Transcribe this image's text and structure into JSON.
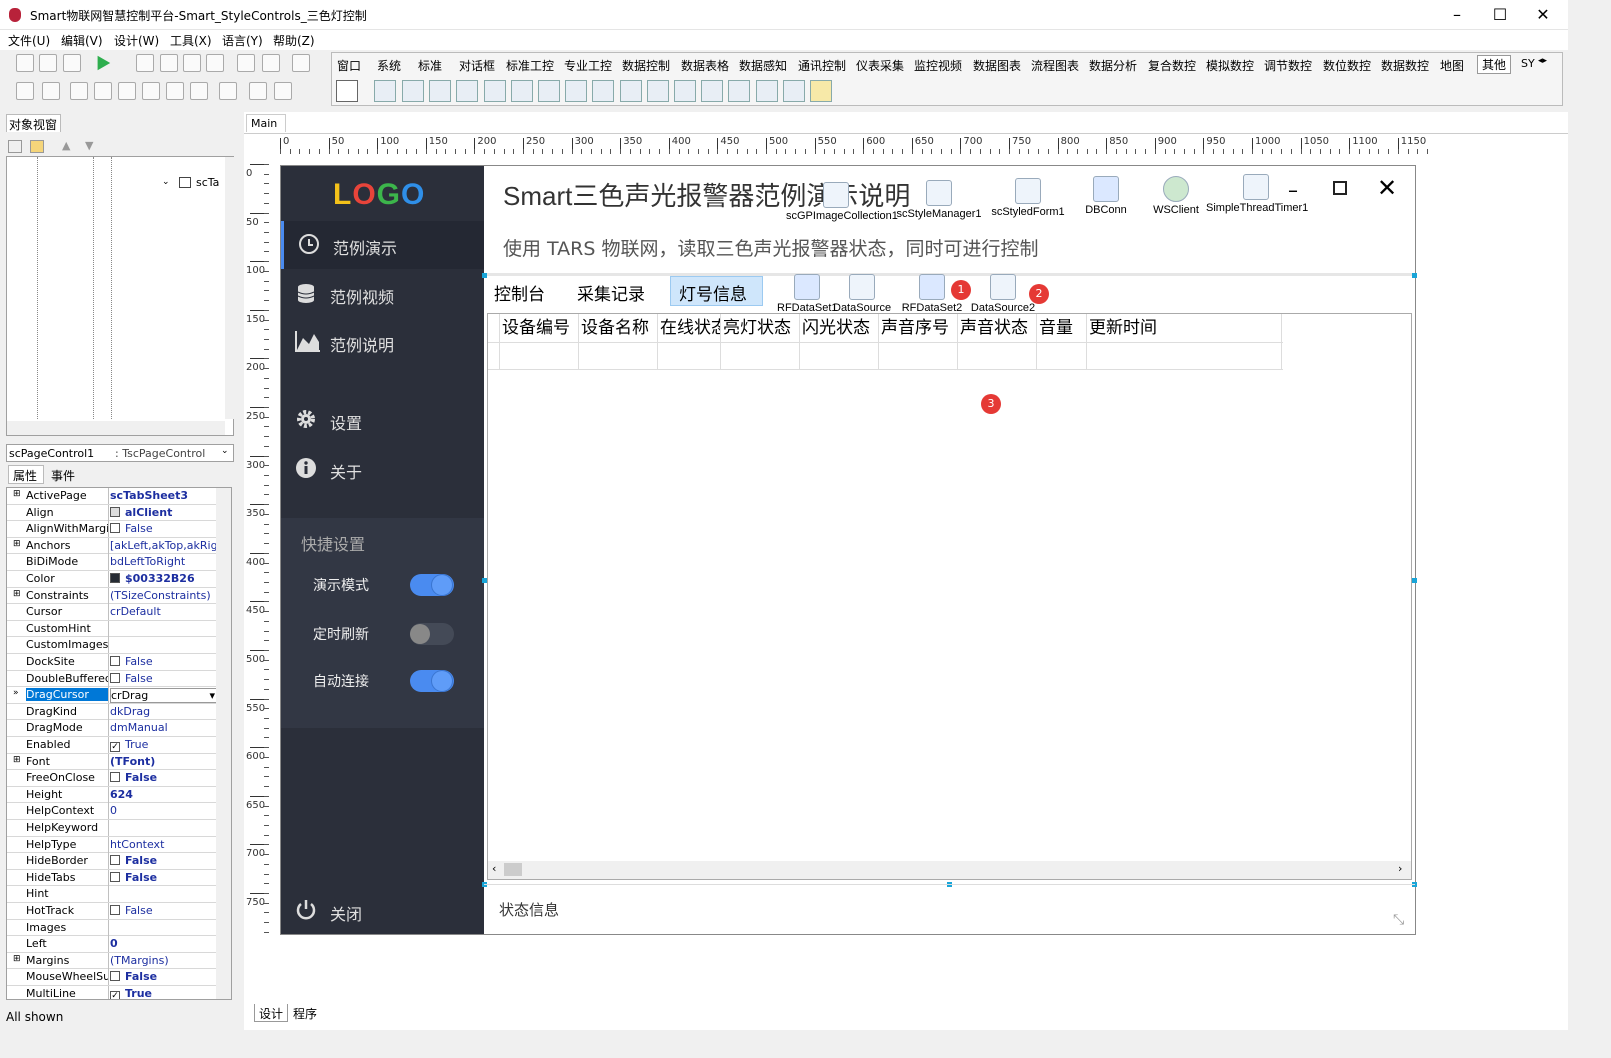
{
  "window": {
    "title": "Smart物联网智慧控制平台-Smart_StyleControls_三色灯控制",
    "min": "–",
    "max": "☐",
    "close": "✕"
  },
  "menu": [
    "文件(U)",
    "编辑(V)",
    "设计(W)",
    "工具(X)",
    "语言(Y)",
    "帮助(Z)"
  ],
  "palette_tabs": [
    "窗口",
    "系统",
    "标准",
    "对话框",
    "标准工控",
    "专业工控",
    "数据控制",
    "数据表格",
    "数据感知",
    "通讯控制",
    "仪表采集",
    "监控视频",
    "数据图表",
    "流程图表",
    "数据分析",
    "复合数控",
    "模拟数控",
    "调节数控",
    "数位数控",
    "数据数控",
    "地图",
    "其他",
    "SY"
  ],
  "left": {
    "object_view_title": "对象视窗",
    "tree_root": "scTa",
    "component_combo": "scPageControl1",
    "component_type": ": TscPageControl",
    "tab_props": "属性",
    "tab_events": "事件",
    "status": "All shown"
  },
  "props": [
    {
      "name": "ActivePage",
      "value": "scTabSheet3",
      "bold": true,
      "plus": true
    },
    {
      "name": "Align",
      "value": "alClient",
      "bold": true,
      "swatch": "#ddd"
    },
    {
      "name": "AlignWithMargins",
      "value": "False",
      "check": false
    },
    {
      "name": "Anchors",
      "value": "[akLeft,akTop,akRight",
      "plus": true
    },
    {
      "name": "BiDiMode",
      "value": "bdLeftToRight"
    },
    {
      "name": "Color",
      "value": "$00332B26",
      "bold": true,
      "swatch": "#262B33"
    },
    {
      "name": "Constraints",
      "value": "(TSizeConstraints)",
      "plus": true
    },
    {
      "name": "Cursor",
      "value": "crDefault"
    },
    {
      "name": "CustomHint",
      "value": ""
    },
    {
      "name": "CustomImages",
      "value": ""
    },
    {
      "name": "DockSite",
      "value": "False",
      "check": false
    },
    {
      "name": "DoubleBuffered",
      "value": "False",
      "check": false
    },
    {
      "name": "DragCursor",
      "value": "crDrag",
      "selected": true
    },
    {
      "name": "DragKind",
      "value": "dkDrag"
    },
    {
      "name": "DragMode",
      "value": "dmManual"
    },
    {
      "name": "Enabled",
      "value": "True",
      "check": true
    },
    {
      "name": "Font",
      "value": "(TFont)",
      "bold": true,
      "plus": true
    },
    {
      "name": "FreeOnClose",
      "value": "False",
      "bold": true,
      "check": false
    },
    {
      "name": "Height",
      "value": "624",
      "bold": true
    },
    {
      "name": "HelpContext",
      "value": "0"
    },
    {
      "name": "HelpKeyword",
      "value": ""
    },
    {
      "name": "HelpType",
      "value": "htContext"
    },
    {
      "name": "HideBorder",
      "value": "False",
      "bold": true,
      "check": false
    },
    {
      "name": "HideTabs",
      "value": "False",
      "bold": true,
      "check": false
    },
    {
      "name": "Hint",
      "value": ""
    },
    {
      "name": "HotTrack",
      "value": "False",
      "check": false
    },
    {
      "name": "Images",
      "value": ""
    },
    {
      "name": "Left",
      "value": "0",
      "bold": true
    },
    {
      "name": "Margins",
      "value": "(TMargins)",
      "plus": true
    },
    {
      "name": "MouseWheelSupp",
      "value": "False",
      "bold": true,
      "check": false
    },
    {
      "name": "MultiLine",
      "value": "True",
      "bold": true,
      "check": true
    }
  ],
  "design": {
    "tab": "Main",
    "bottom_tabs": [
      "设计",
      "程序"
    ],
    "ruler_h": [
      "0",
      "50",
      "100",
      "150",
      "200",
      "250",
      "300",
      "350",
      "400",
      "450",
      "500",
      "550",
      "600",
      "650",
      "700",
      "750",
      "800",
      "850",
      "900",
      "950",
      "1000",
      "1050",
      "1100",
      "1150"
    ],
    "ruler_v": [
      "0",
      "50",
      "100",
      "150",
      "200",
      "250",
      "300",
      "350",
      "400",
      "450",
      "500",
      "550",
      "600",
      "650",
      "700",
      "750"
    ]
  },
  "form": {
    "logo": "LOGO",
    "nav": [
      "范例演示",
      "范例视频",
      "范例说明",
      "设置",
      "关于"
    ],
    "quick_title": "快捷设置",
    "quick": [
      {
        "label": "演示模式",
        "on": true
      },
      {
        "label": "定时刷新",
        "on": false
      },
      {
        "label": "自动连接",
        "on": true
      }
    ],
    "close": "关闭",
    "title": "Smart三色声光报警器范例演示说明",
    "subtitle": "使用 TARS 物联网，读取三色声光报警器状态，同时可进行控制",
    "tabs": [
      "控制台",
      "采集记录",
      "灯号信息"
    ],
    "columns": [
      "设备编号",
      "设备名称",
      "在线状态",
      "亮灯状态",
      "闪光状态",
      "声音序号",
      "声音状态",
      "音量",
      "更新时间"
    ],
    "status_text": "状态信息",
    "components": [
      "scGPImageCollection1",
      "scStyleManager1",
      "scStyledForm1",
      "DBConn",
      "WSClient",
      "SimpleThreadTimer1",
      "RFDataSet1",
      "DataSource1",
      "RFDataSet2",
      "DataSource2"
    ],
    "badges": [
      "1",
      "2",
      "3"
    ]
  },
  "colors": {
    "sidebar": "#2b2f3a",
    "accent": "#4a8bf0",
    "badge": "#e53935",
    "active_tab": "#cfe6fb"
  }
}
